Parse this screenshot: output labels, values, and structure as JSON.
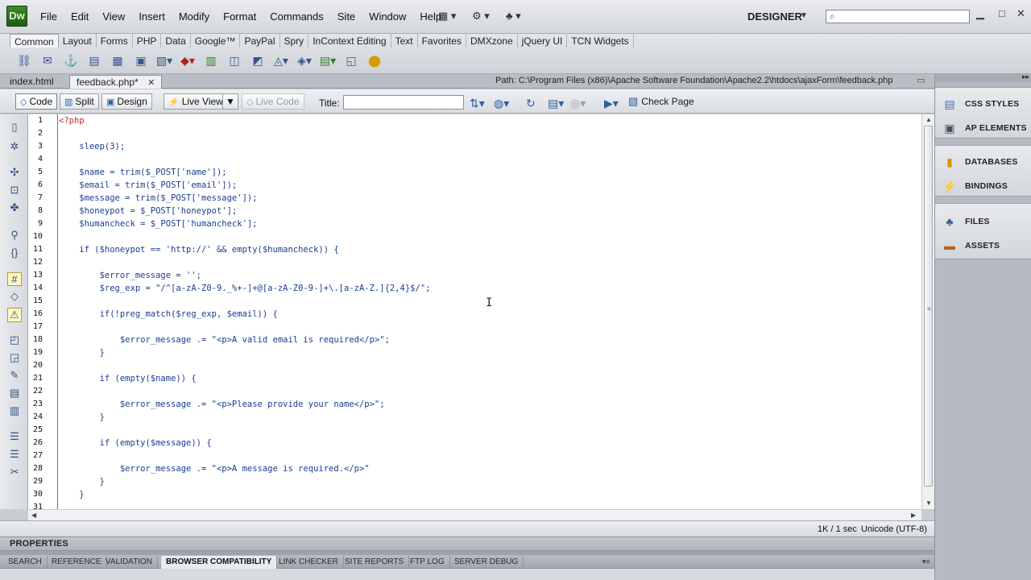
{
  "app": {
    "logo_text": "Dw",
    "workspace": "DESIGNER",
    "menus": [
      "File",
      "Edit",
      "View",
      "Insert",
      "Modify",
      "Format",
      "Commands",
      "Site",
      "Window",
      "Help"
    ]
  },
  "insert_bar": {
    "tabs": [
      "Common",
      "Layout",
      "Forms",
      "PHP",
      "Data",
      "Google™",
      "PayPal",
      "Spry",
      "InContext Editing",
      "Text",
      "Favorites",
      "DMXzone",
      "jQuery UI",
      "TCN Widgets"
    ]
  },
  "document_tabs": [
    {
      "label": "index.html"
    },
    {
      "label": "feedback.php*"
    }
  ],
  "path": "Path:  C:\\Program Files (x86)\\Apache Software Foundation\\Apache2.2\\htdocs\\ajaxForm\\feedback.php",
  "document_toolbar": {
    "code": "Code",
    "split": "Split",
    "design": "Design",
    "live_view": "Live View",
    "live_code": "Live Code",
    "title_label": "Title:",
    "title_value": "",
    "check_page": "Check Page"
  },
  "code_lines": [
    {
      "n": "1",
      "text": "<?php",
      "tag": true
    },
    {
      "n": "2",
      "text": ""
    },
    {
      "n": "3",
      "text": "    sleep(3);"
    },
    {
      "n": "4",
      "text": ""
    },
    {
      "n": "5",
      "text": "    $name = trim($_POST['name']);"
    },
    {
      "n": "6",
      "text": "    $email = trim($_POST['email']);"
    },
    {
      "n": "7",
      "text": "    $message = trim($_POST['message']);"
    },
    {
      "n": "8",
      "text": "    $honeypot = $_POST['honeypot'];"
    },
    {
      "n": "9",
      "text": "    $humancheck = $_POST['humancheck'];"
    },
    {
      "n": "10",
      "text": ""
    },
    {
      "n": "11",
      "text": "    if ($honeypot == 'http://' && empty($humancheck)) {"
    },
    {
      "n": "12",
      "text": ""
    },
    {
      "n": "13",
      "text": "        $error_message = '';"
    },
    {
      "n": "14",
      "text": "        $reg_exp = \"/^[a-zA-Z0-9._%+-]+@[a-zA-Z0-9-]+\\.[a-zA-Z.]{2,4}$/\";"
    },
    {
      "n": "15",
      "text": ""
    },
    {
      "n": "16",
      "text": "        if(!preg_match($reg_exp, $email)) {"
    },
    {
      "n": "17",
      "text": ""
    },
    {
      "n": "18",
      "text": "            $error_message .= \"<p>A valid email is required</p>\";"
    },
    {
      "n": "19",
      "text": "        }"
    },
    {
      "n": "20",
      "text": ""
    },
    {
      "n": "21",
      "text": "        if (empty($name)) {"
    },
    {
      "n": "22",
      "text": ""
    },
    {
      "n": "23",
      "text": "            $error_message .= \"<p>Please provide your name</p>\";"
    },
    {
      "n": "24",
      "text": "        }"
    },
    {
      "n": "25",
      "text": ""
    },
    {
      "n": "26",
      "text": "        if (empty($message)) {"
    },
    {
      "n": "27",
      "text": ""
    },
    {
      "n": "28",
      "text": "            $error_message .= \"<p>A message is required.</p>\""
    },
    {
      "n": "29",
      "text": "        }"
    },
    {
      "n": "30",
      "text": "    }"
    },
    {
      "n": "31",
      "text": ""
    }
  ],
  "status": {
    "size": "1K / 1 sec",
    "encoding": "Unicode (UTF-8)"
  },
  "properties_label": "PROPERTIES",
  "results_tabs": [
    "SEARCH",
    "REFERENCE",
    "VALIDATION",
    "BROWSER COMPATIBILITY",
    "LINK CHECKER",
    "SITE REPORTS",
    "FTP LOG",
    "SERVER DEBUG"
  ],
  "right_panels": {
    "css_styles": "CSS STYLES",
    "ap_elements": "AP ELEMENTS",
    "databases": "DATABASES",
    "bindings": "BINDINGS",
    "files": "FILES",
    "assets": "ASSETS"
  }
}
